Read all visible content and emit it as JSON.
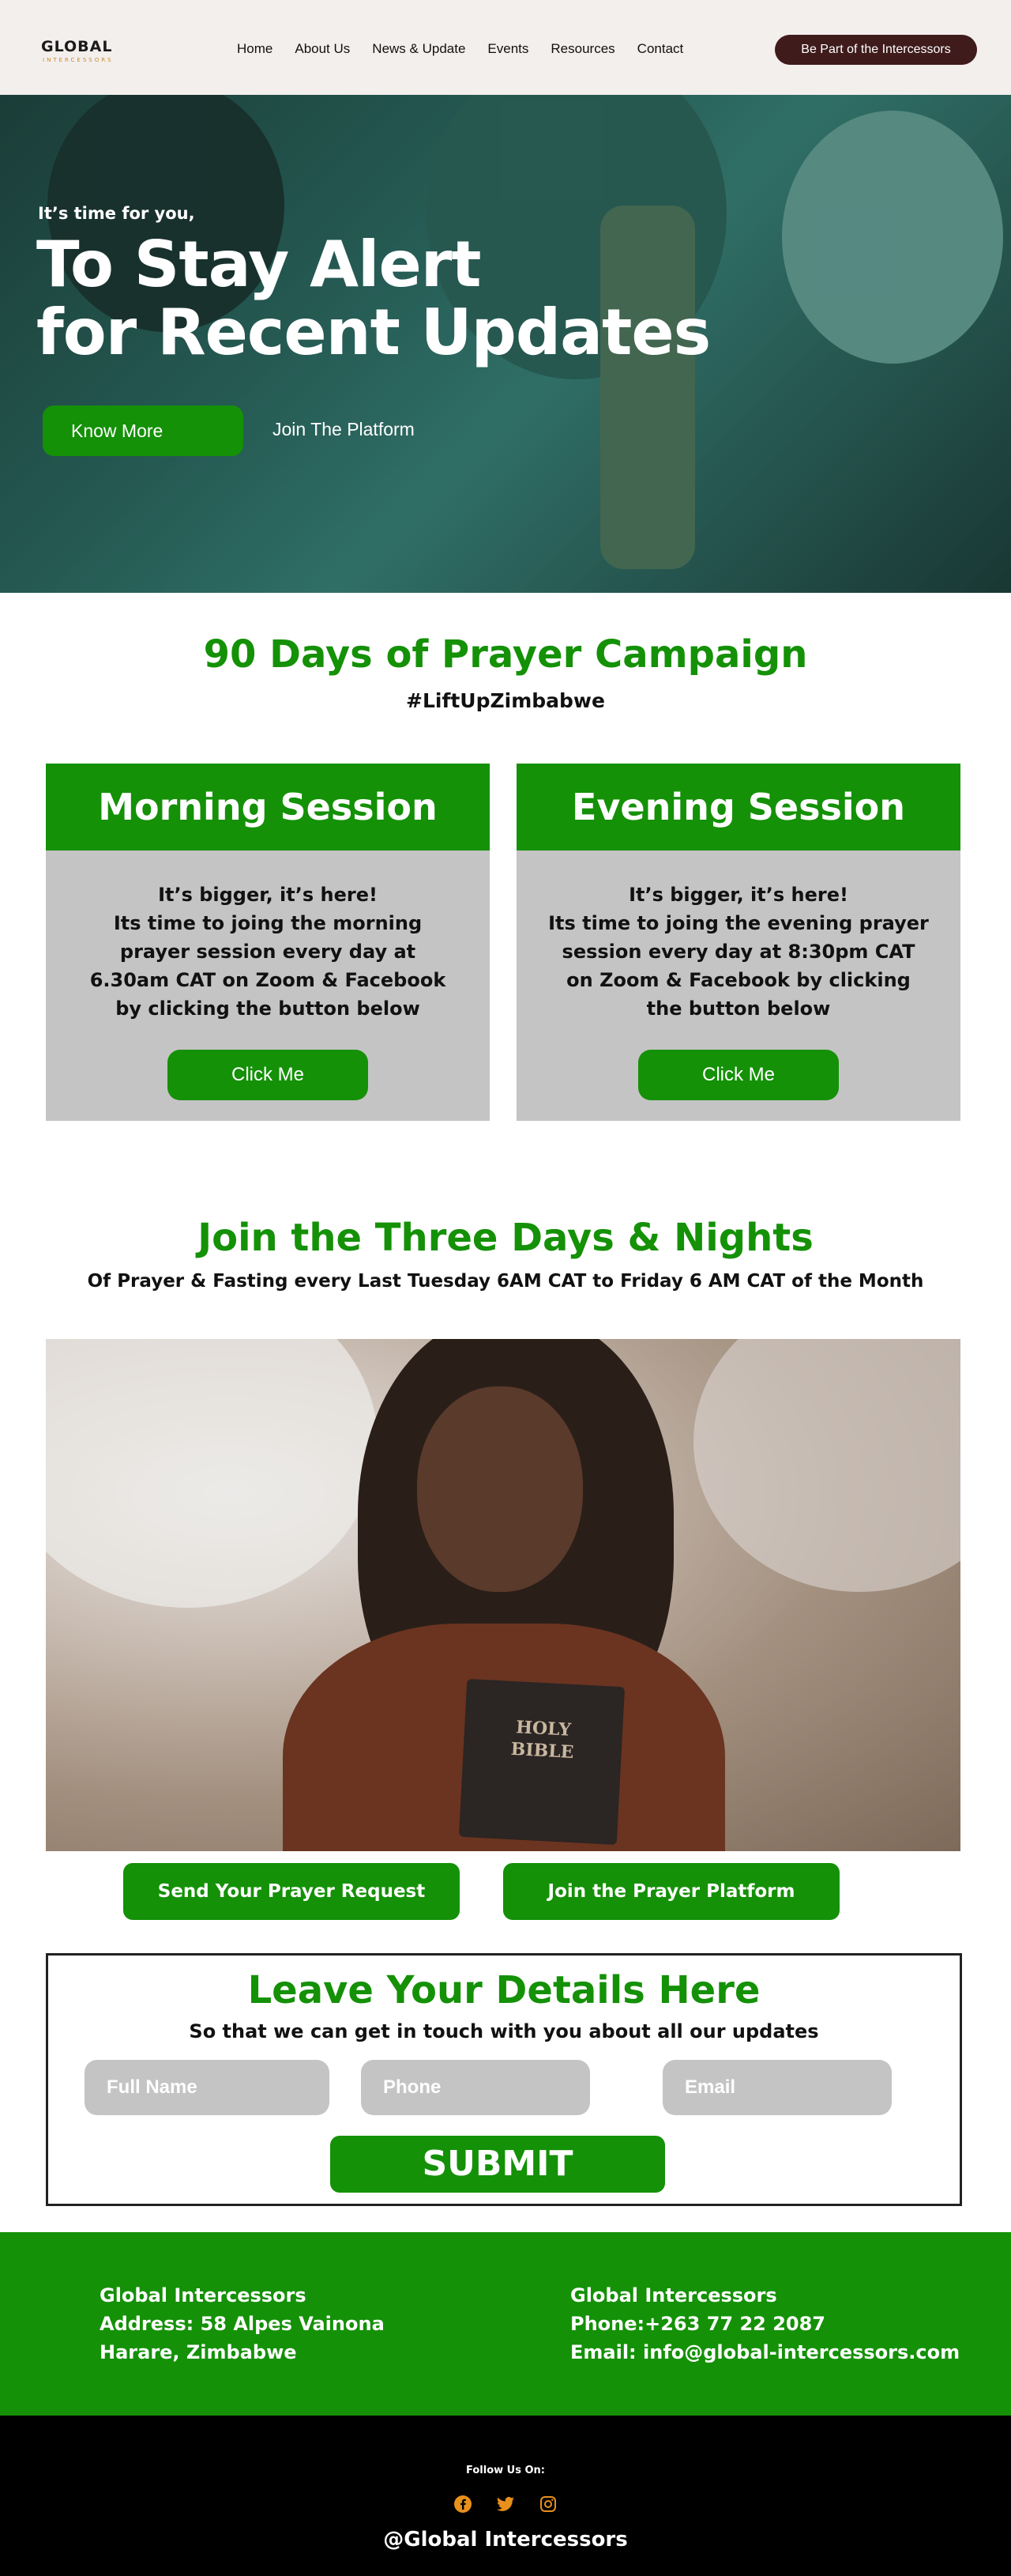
{
  "header": {
    "logo_text": "GLOBAL",
    "logo_subtext": "INTERCESSORS",
    "nav": [
      "Home",
      "About Us",
      "News & Update",
      "Events",
      "Resources",
      "Contact"
    ],
    "cta": "Be Part of the Intercessors"
  },
  "hero": {
    "kicker": "It’s time for you,",
    "title_line1": "To Stay Alert",
    "title_line2": "for Recent Updates",
    "know_more": "Know More",
    "join_platform": "Join The Platform"
  },
  "campaign": {
    "title": "90 Days of Prayer Campaign",
    "hashtag": "#LiftUpZimbabwe",
    "sessions": [
      {
        "title": "Morning Session",
        "line1": "It’s bigger, it’s here!",
        "body": "Its time to joing the morning prayer session every day at 6.30am CAT on Zoom & Facebook by clicking the button below",
        "button": "Click Me"
      },
      {
        "title": "Evening Session",
        "line1": "It’s bigger, it’s here!",
        "body": "Its time to joing the evening prayer session every day at 8:30pm  CAT on Zoom & Facebook by clicking the button below",
        "button": "Click Me"
      }
    ]
  },
  "three_days": {
    "title": "Join the Three Days & Nights",
    "subtitle": "Of Prayer & Fasting every Last Tuesday 6AM CAT  to Friday  6 AM CAT of the Month",
    "bible_text": "HOLY\nBIBLE",
    "prayer_request": "Send  Your Prayer Request",
    "prayer_platform": "Join the Prayer Platform"
  },
  "form": {
    "title": "Leave Your Details Here",
    "subtitle": "So that we can get in touch with you about all our updates",
    "full_name_placeholder": "Full Name",
    "phone_placeholder": "Phone",
    "email_placeholder": "Email",
    "submit": "SUBMIT"
  },
  "footer": {
    "left": [
      "Global Intercessors",
      "Address: 58 Alpes Vainona",
      "Harare, Zimbabwe"
    ],
    "right": [
      "Global Intercessors",
      "Phone:+263 77 22 2087",
      "Email: info@global-intercessors.com"
    ],
    "follow": "Follow Us On:",
    "social_icons": [
      "facebook-icon",
      "twitter-icon",
      "instagram-icon"
    ],
    "handle": "@Global Intercessors"
  },
  "colors": {
    "brand_green": "#149107",
    "header_bg": "#f3efed",
    "cta_bg": "#3f1b1b",
    "icon_orange": "#e8901c"
  }
}
